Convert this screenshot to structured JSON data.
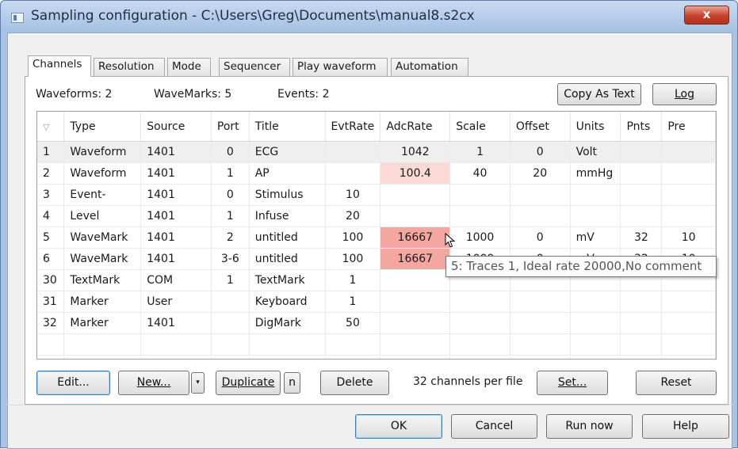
{
  "window": {
    "title": "Sampling configuration - C:\\Users\\Greg\\Documents\\manual8.s2cx",
    "close_label": "x"
  },
  "tabs": [
    {
      "label": "Channels",
      "active": true
    },
    {
      "label": "Resolution",
      "active": false
    },
    {
      "label": "Mode",
      "active": false
    },
    {
      "label": "Sequencer",
      "active": false
    },
    {
      "label": "Play waveform",
      "active": false
    },
    {
      "label": "Automation",
      "active": false
    }
  ],
  "counts": {
    "waveforms": "Waveforms: 2",
    "wavemarks": "WaveMarks: 5",
    "events": "Events: 2"
  },
  "top_buttons": {
    "copy_as_text": "Copy As Text",
    "log": "Log"
  },
  "table": {
    "sort_icon": "▽",
    "columns": [
      "Type",
      "Source",
      "Port",
      "Title",
      "EvtRate",
      "AdcRate",
      "Scale",
      "Offset",
      "Units",
      "Pnts",
      "Pre"
    ],
    "rows": [
      {
        "num": "1",
        "type": "Waveform",
        "source": "1401",
        "port": "0",
        "title": "ECG",
        "evtrate": "",
        "adcrate": "1042",
        "scale": "1",
        "offset": "0",
        "units": "Volt",
        "pnts": "",
        "pre": ""
      },
      {
        "num": "2",
        "type": "Waveform",
        "source": "1401",
        "port": "1",
        "title": "AP",
        "evtrate": "",
        "adcrate": "100.4",
        "scale": "40",
        "offset": "20",
        "units": "mmHg",
        "pnts": "",
        "pre": ""
      },
      {
        "num": "3",
        "type": "Event-",
        "source": "1401",
        "port": "0",
        "title": "Stimulus",
        "evtrate": "10",
        "adcrate": "",
        "scale": "",
        "offset": "",
        "units": "",
        "pnts": "",
        "pre": ""
      },
      {
        "num": "4",
        "type": "Level",
        "source": "1401",
        "port": "1",
        "title": "Infuse",
        "evtrate": "20",
        "adcrate": "",
        "scale": "",
        "offset": "",
        "units": "",
        "pnts": "",
        "pre": ""
      },
      {
        "num": "5",
        "type": "WaveMark",
        "source": "1401",
        "port": "2",
        "title": "untitled",
        "evtrate": "100",
        "adcrate": "16667",
        "scale": "1000",
        "offset": "0",
        "units": "mV",
        "pnts": "32",
        "pre": "10"
      },
      {
        "num": "6",
        "type": "WaveMark",
        "source": "1401",
        "port": "3-6",
        "title": "untitled",
        "evtrate": "100",
        "adcrate": "16667",
        "scale": "1000",
        "offset": "0",
        "units": "mV",
        "pnts": "32",
        "pre": "10"
      },
      {
        "num": "30",
        "type": "TextMark",
        "source": "COM",
        "port": "1",
        "title": "TextMark",
        "evtrate": "1",
        "adcrate": "",
        "scale": "",
        "offset": "",
        "units": "",
        "pnts": "",
        "pre": ""
      },
      {
        "num": "31",
        "type": "Marker",
        "source": "User",
        "port": "",
        "title": "Keyboard",
        "evtrate": "1",
        "adcrate": "",
        "scale": "",
        "offset": "",
        "units": "",
        "pnts": "",
        "pre": ""
      },
      {
        "num": "32",
        "type": "Marker",
        "source": "1401",
        "port": "",
        "title": "DigMark",
        "evtrate": "50",
        "adcrate": "",
        "scale": "",
        "offset": "",
        "units": "",
        "pnts": "",
        "pre": ""
      }
    ]
  },
  "tooltip": "5: Traces 1, Ideal rate 20000,No comment",
  "bottom_row": {
    "edit": "Edit...",
    "new": "New...",
    "dropdown_arrow": "▾",
    "duplicate": "Duplicate",
    "n": "n",
    "delete": "Delete",
    "channels_per_file": "32 channels per file",
    "set": "Set...",
    "reset": "Reset"
  },
  "dialog_buttons": {
    "ok": "OK",
    "cancel": "Cancel",
    "run_now": "Run now",
    "help": "Help"
  },
  "colors": {
    "highlight_light": "#fbd9d4",
    "highlight_dark": "#f4a6a0",
    "close_button": "#c4412a"
  }
}
